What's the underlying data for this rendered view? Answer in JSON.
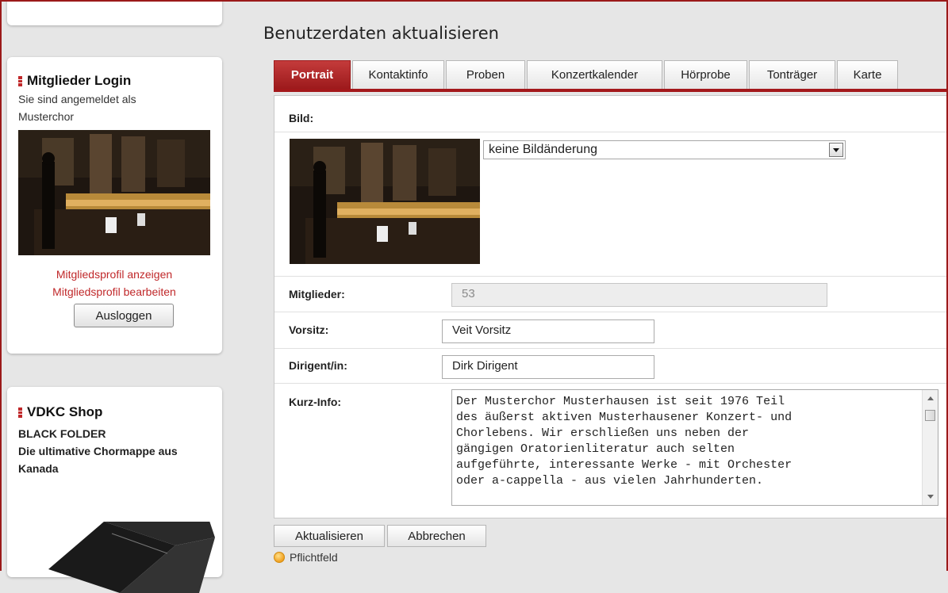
{
  "sidebar": {
    "login": {
      "title": "Mitglieder Login",
      "logged_in_text": "Sie sind angemeldet als Musterchor",
      "profile_show": "Mitgliedsprofil anzeigen",
      "profile_edit": "Mitgliedsprofil bearbeiten",
      "logout_label": "Ausloggen"
    },
    "shop": {
      "title": "VDKC Shop",
      "product_name": "BLACK FOLDER",
      "product_desc": "Die ultimative Chormappe aus Kanada"
    }
  },
  "main": {
    "title": "Benutzerdaten aktualisieren",
    "tabs": [
      {
        "label": "Portrait",
        "active": true
      },
      {
        "label": "Kontaktinfo",
        "active": false
      },
      {
        "label": "Proben",
        "active": false
      },
      {
        "label": "Konzertkalender",
        "active": false
      },
      {
        "label": "Hörprobe",
        "active": false
      },
      {
        "label": "Tonträger",
        "active": false
      },
      {
        "label": "Karte",
        "active": false
      }
    ],
    "form": {
      "image_label": "Bild:",
      "image_select_value": "keine Bildänderung",
      "members_label": "Mitglieder:",
      "members_value": "53",
      "chair_label": "Vorsitz:",
      "chair_value": "Veit Vorsitz",
      "conductor_label": "Dirigent/in:",
      "conductor_value": "Dirk Dirigent",
      "info_label": "Kurz-Info:",
      "info_value": "Der Musterchor Musterhausen ist seit 1976 Teil\ndes äußerst aktiven Musterhausener Konzert- und\nChorlebens. Wir erschließen uns neben der\ngängigen Oratorienliteratur auch selten\naufgeführte, interessante Werke - mit Orchester\noder a-cappella - aus vielen Jahrhunderten."
    },
    "buttons": {
      "update_label": "Aktualisieren",
      "cancel_label": "Abbrechen"
    },
    "required_note": "Pflichtfeld"
  },
  "colors": {
    "accent": "#a3181b",
    "link": "#c0282a"
  }
}
